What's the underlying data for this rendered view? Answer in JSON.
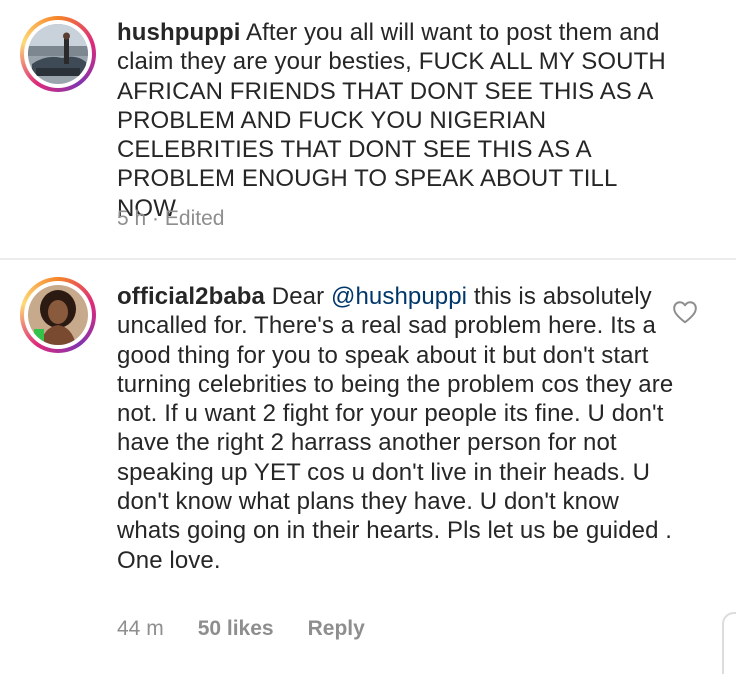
{
  "comments": [
    {
      "username": "hushpuppi",
      "text": "After you all will want to post them and claim they are your besties, FUCK ALL MY SOUTH AFRICAN FRIENDS THAT DONT SEE THIS AS A PROBLEM AND FUCK YOU NIGERIAN CELEBRITIES THAT DONT SEE THIS AS A PROBLEM ENOUGH TO SPEAK ABOUT TILL NOW",
      "time": "5 h",
      "separator": "·",
      "edited": "Edited"
    },
    {
      "username": "official2baba",
      "text_before_mention": "Dear ",
      "mention": "@hushpuppi",
      "text_after_mention": " this is absolutely uncalled for. There's a real sad problem here. Its a good thing for you to speak about it but don't start turning celebrities to being the problem cos they are not. If u want 2 fight for your people its fine. U don't  have the right 2 harrass another person for not speaking up YET cos u don't live in their heads. U don't know what plans they have. U don't know whats going on in their hearts. Pls let us be guided . One love.",
      "time": "44 m",
      "likes": "50 likes",
      "reply_label": "Reply",
      "like_icon": "heart-outline-icon"
    }
  ],
  "colors": {
    "text": "#262626",
    "meta": "#8e8e8e",
    "mention": "#00376b",
    "divider": "#ececec"
  }
}
